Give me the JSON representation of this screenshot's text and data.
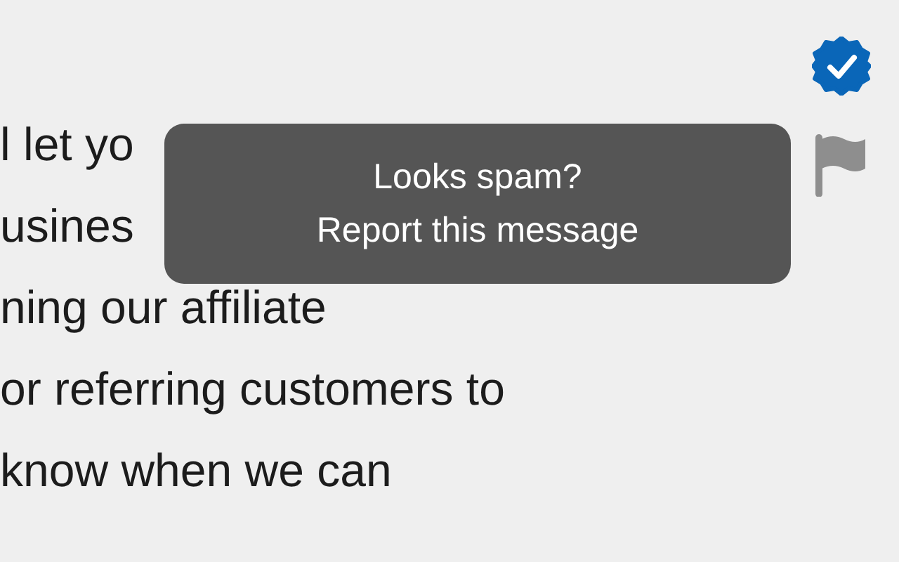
{
  "message_lines": [
    "l let yo",
    "usines",
    "ning our affiliate",
    "or referring customers to",
    "know when we can"
  ],
  "verified": true,
  "tooltip": {
    "lines": [
      "Looks spam?",
      "Report this message"
    ]
  }
}
